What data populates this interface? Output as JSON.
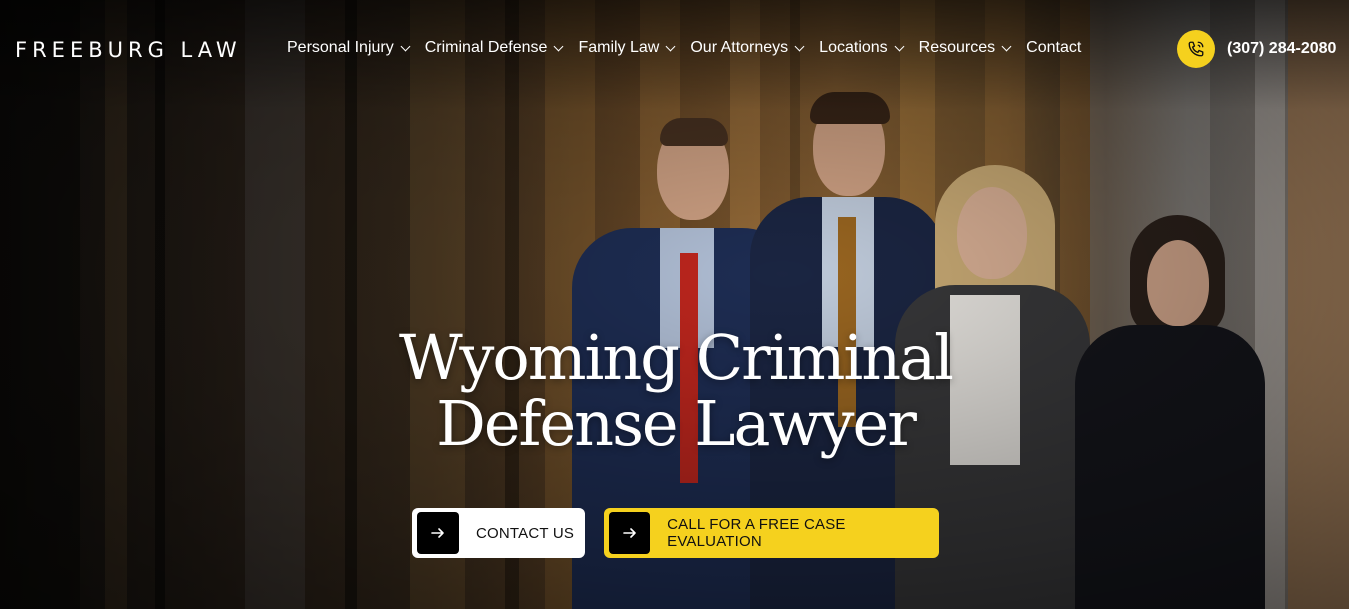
{
  "brand": {
    "logo_text": "FREEBURG LAW"
  },
  "nav": {
    "items": [
      {
        "label": "Personal Injury",
        "has_dropdown": true
      },
      {
        "label": "Criminal Defense",
        "has_dropdown": true
      },
      {
        "label": "Family Law",
        "has_dropdown": true
      },
      {
        "label": "Our Attorneys",
        "has_dropdown": true
      },
      {
        "label": "Locations",
        "has_dropdown": true
      },
      {
        "label": "Resources",
        "has_dropdown": true
      },
      {
        "label": "Contact",
        "has_dropdown": false
      }
    ]
  },
  "header": {
    "phone": "(307) 284-2080",
    "phone_icon": "phone-icon"
  },
  "hero": {
    "title_line1": "Wyoming Criminal",
    "title_line2": "Defense Lawyer",
    "cta_contact": "CONTACT US",
    "cta_call": "CALL FOR A FREE CASE EVALUATION",
    "arrow_icon": "arrow-right-icon"
  },
  "colors": {
    "accent": "#f5d11e",
    "text": "#ffffff",
    "button_dark": "#000000"
  }
}
